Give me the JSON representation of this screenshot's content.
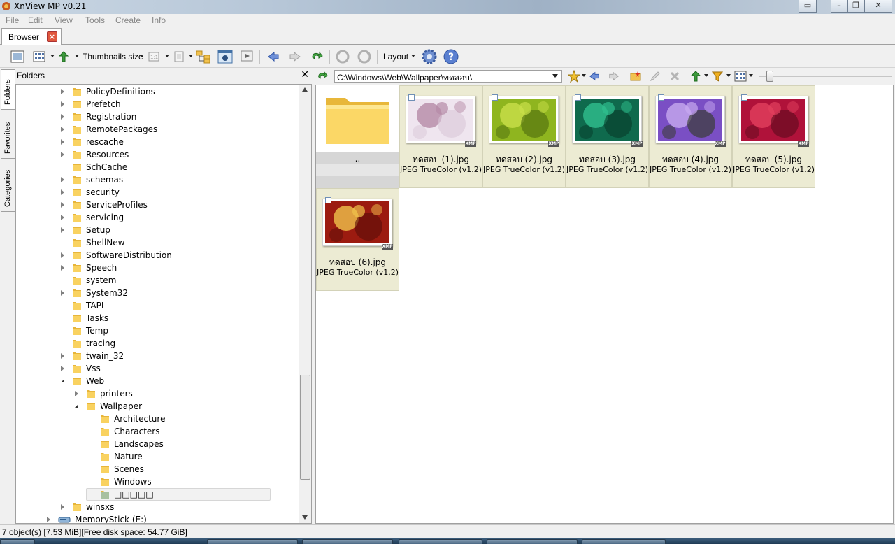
{
  "window": {
    "title": "XnView MP v0.21"
  },
  "menu": [
    "File",
    "Edit",
    "View",
    "Tools",
    "Create",
    "Info"
  ],
  "tabs": [
    {
      "label": "Browser"
    }
  ],
  "toolbar": {
    "thumbnails_size_label": "Thumbnails size",
    "layout_label": "Layout"
  },
  "side_tabs": [
    "Folders",
    "Favorites",
    "Categories"
  ],
  "folders_panel": {
    "title": "Folders",
    "tree": [
      {
        "label": "PolicyDefinitions",
        "state": "collapsed"
      },
      {
        "label": "Prefetch",
        "state": "collapsed"
      },
      {
        "label": "Registration",
        "state": "collapsed"
      },
      {
        "label": "RemotePackages",
        "state": "collapsed"
      },
      {
        "label": "rescache",
        "state": "collapsed"
      },
      {
        "label": "Resources",
        "state": "collapsed"
      },
      {
        "label": "SchCache",
        "state": "none"
      },
      {
        "label": "schemas",
        "state": "collapsed"
      },
      {
        "label": "security",
        "state": "collapsed"
      },
      {
        "label": "ServiceProfiles",
        "state": "collapsed"
      },
      {
        "label": "servicing",
        "state": "collapsed"
      },
      {
        "label": "Setup",
        "state": "collapsed"
      },
      {
        "label": "ShellNew",
        "state": "none"
      },
      {
        "label": "SoftwareDistribution",
        "state": "collapsed"
      },
      {
        "label": "Speech",
        "state": "collapsed"
      },
      {
        "label": "system",
        "state": "none"
      },
      {
        "label": "System32",
        "state": "collapsed"
      },
      {
        "label": "TAPI",
        "state": "none"
      },
      {
        "label": "Tasks",
        "state": "none"
      },
      {
        "label": "Temp",
        "state": "none"
      },
      {
        "label": "tracing",
        "state": "none"
      },
      {
        "label": "twain_32",
        "state": "collapsed"
      },
      {
        "label": "Vss",
        "state": "collapsed"
      },
      {
        "label": "Web",
        "state": "expanded"
      },
      {
        "label": "printers",
        "state": "collapsed"
      },
      {
        "label": "Wallpaper",
        "state": "expanded"
      },
      {
        "label": "Architecture",
        "state": "none"
      },
      {
        "label": "Characters",
        "state": "none"
      },
      {
        "label": "Landscapes",
        "state": "none"
      },
      {
        "label": "Nature",
        "state": "none"
      },
      {
        "label": "Scenes",
        "state": "none"
      },
      {
        "label": "Windows",
        "state": "none"
      },
      {
        "label": "□□□□□",
        "state": "none",
        "selected": true
      },
      {
        "label": "winsxs",
        "state": "collapsed"
      },
      {
        "label": "MemoryStick (E:)",
        "state": "collapsed",
        "drive": true
      }
    ]
  },
  "path": {
    "value": "C:\\Windows\\Web\\Wallpaper\\ทดสอบ\\"
  },
  "thumbnails": {
    "parent_label": "..",
    "items": [
      {
        "name": "ทดสอบ (1).jpg",
        "format": "JPEG TrueColor (v1.2)",
        "badge": "XMP",
        "palette": [
          "#efe5ef",
          "#b58aa6",
          "#d9c7d7"
        ]
      },
      {
        "name": "ทดสอบ (2).jpg",
        "format": "JPEG TrueColor (v1.2)",
        "badge": "XMP",
        "palette": [
          "#8fb51f",
          "#c9e04a",
          "#4c6b0d"
        ]
      },
      {
        "name": "ทดสอบ (3).jpg",
        "format": "JPEG TrueColor (v1.2)",
        "badge": "XMP",
        "palette": [
          "#0f6a4d",
          "#2fbf8e",
          "#063a2a"
        ]
      },
      {
        "name": "ทดสอบ (4).jpg",
        "format": "JPEG TrueColor (v1.2)",
        "badge": "XMP",
        "palette": [
          "#7a4fc4",
          "#c7a9ef",
          "#2f3a1f"
        ]
      },
      {
        "name": "ทดสอบ (5).jpg",
        "format": "JPEG TrueColor (v1.2)",
        "badge": "XMP",
        "palette": [
          "#b0123a",
          "#e2405e",
          "#5c0a1c"
        ]
      },
      {
        "name": "ทดสอบ (6).jpg",
        "format": "JPEG TrueColor (v1.2)",
        "badge": "XMP",
        "palette": [
          "#9c1b10",
          "#f0c24b",
          "#5a0d08"
        ]
      }
    ]
  },
  "status": {
    "text": "7 object(s) [7.53 MiB][Free disk space: 54.77 GiB]"
  },
  "colors": {
    "selected_cell": "#ecebd3",
    "accent": "#3a78c2"
  }
}
